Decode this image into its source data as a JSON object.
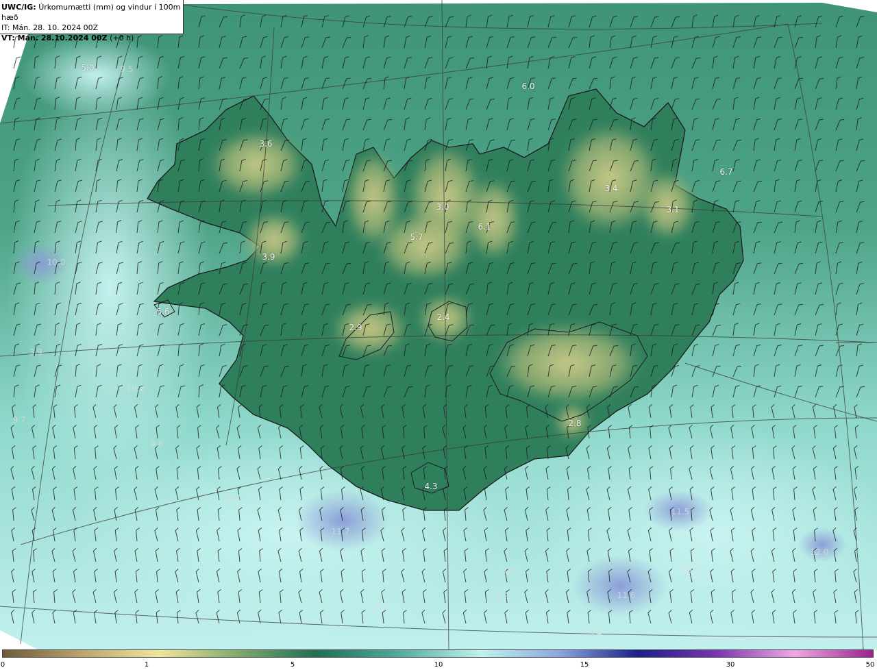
{
  "header": {
    "line1_bold": "UWC/IG:",
    "line1_rest": "Úrkomumætti (mm) og vindur í 100m hæð",
    "line2": "IT: Mán. 28. 10. 2024 00Z",
    "line3_bold": "VT: Mán. 28.10.2024 00Z",
    "line3_rest": "(+0 h)"
  },
  "labels": [
    {
      "id": "l1",
      "text": "5.0"
    },
    {
      "id": "l2",
      "text": "9.5"
    },
    {
      "id": "l3",
      "text": "6.0"
    },
    {
      "id": "l4",
      "text": "3.6"
    },
    {
      "id": "l5",
      "text": "6.7"
    },
    {
      "id": "l6",
      "text": "3.4"
    },
    {
      "id": "l7",
      "text": "3.0"
    },
    {
      "id": "l8",
      "text": "3.1"
    },
    {
      "id": "l9",
      "text": "6.1"
    },
    {
      "id": "l10",
      "text": "5.7"
    },
    {
      "id": "l11",
      "text": "3.9"
    },
    {
      "id": "l12",
      "text": "10.0"
    },
    {
      "id": "l13",
      "text": "5.6"
    },
    {
      "id": "l14",
      "text": "2.9"
    },
    {
      "id": "l15",
      "text": "2.4"
    },
    {
      "id": "l16",
      "text": "3.9"
    },
    {
      "id": "l17",
      "text": "10.2"
    },
    {
      "id": "l18",
      "text": "9.7"
    },
    {
      "id": "l19",
      "text": "9.6"
    },
    {
      "id": "l20",
      "text": "2.8"
    },
    {
      "id": "l21",
      "text": "4.3"
    },
    {
      "id": "l22",
      "text": "10.4"
    },
    {
      "id": "l23",
      "text": "11.7"
    },
    {
      "id": "l24",
      "text": "11.5"
    },
    {
      "id": "l25",
      "text": "10.9"
    },
    {
      "id": "l26",
      "text": "9.2"
    },
    {
      "id": "l27",
      "text": "10.8"
    },
    {
      "id": "l28",
      "text": "11.6"
    },
    {
      "id": "l29",
      "text": "9.3"
    },
    {
      "id": "l30",
      "text": "9.4"
    },
    {
      "id": "l31",
      "text": "12.0"
    }
  ],
  "colorscale": {
    "ticks": [
      "0",
      "1",
      "5",
      "10",
      "15",
      "30",
      "50"
    ],
    "colors": [
      "#6e5a3a",
      "#b9a46a",
      "#f0e69a",
      "#7faa6a",
      "#1f6f55",
      "#4aa898",
      "#bff3ee",
      "#8aa6df",
      "#1a1f8c",
      "#7a35b0",
      "#f0a8e4",
      "#9b1f8f"
    ]
  },
  "map_colors": {
    "sea_offshore": "#b8ecea",
    "sea_mid": "#5fae98",
    "land_low": "#2d7e5f",
    "highland": "#c7c684",
    "precip_peak": "#8f9fd8"
  }
}
